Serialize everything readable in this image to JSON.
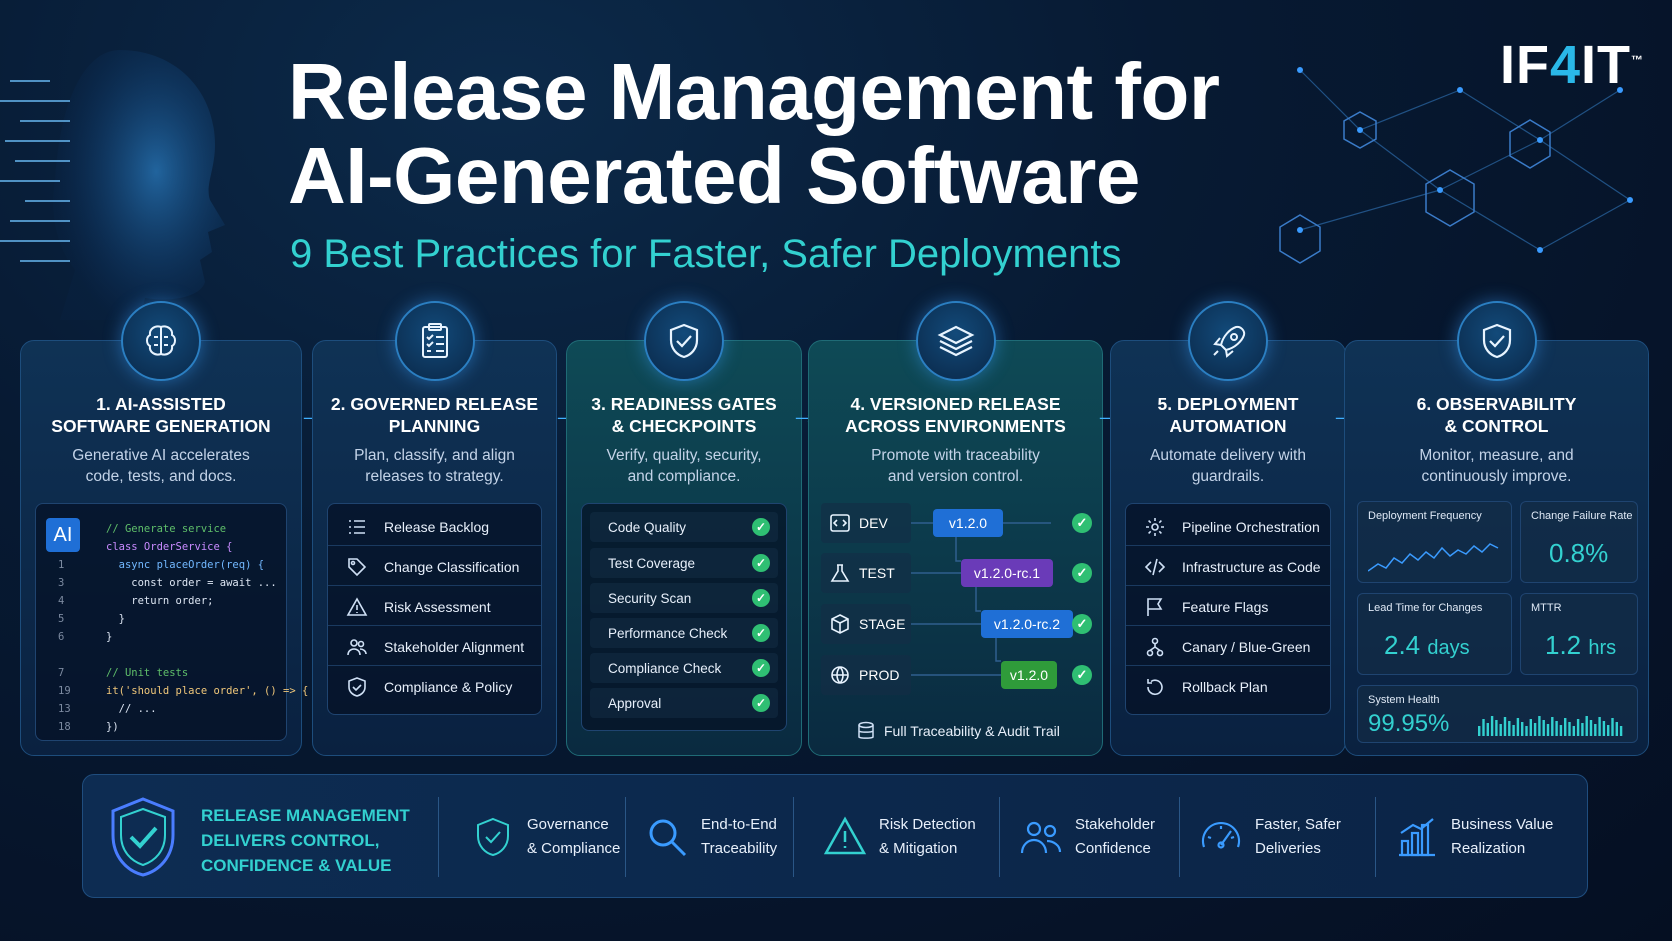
{
  "header": {
    "title_line1": "Release Management for",
    "title_line2": "AI-Generated Software",
    "subtitle": "9 Best Practices for Faster, Safer Deployments",
    "logo_prefix": "IF",
    "logo_four": "4",
    "logo_suffix": "IT",
    "logo_tm": "™"
  },
  "colors": {
    "accent_teal": "#33d1d0",
    "accent_blue": "#2ab8e8",
    "check_green": "#2fbf73",
    "background": "#071a33"
  },
  "steps": [
    {
      "title_line1": "1. AI-ASSISTED",
      "title_line2": "SOFTWARE GENERATION",
      "desc_line1": "Generative AI accelerates",
      "desc_line2": "code, tests, and docs.",
      "icon": "brain-icon"
    },
    {
      "title_line1": "2. GOVERNED RELEASE",
      "title_line2": "PLANNING",
      "desc_line1": "Plan, classify, and align",
      "desc_line2": "releases to strategy.",
      "icon": "clipboard-icon"
    },
    {
      "title_line1": "3. READINESS GATES",
      "title_line2": "& CHECKPOINTS",
      "desc_line1": "Verify, quality, security,",
      "desc_line2": "and compliance.",
      "icon": "shield-check-icon"
    },
    {
      "title_line1": "4. VERSIONED RELEASE",
      "title_line2": "ACROSS ENVIRONMENTS",
      "desc_line1": "Promote with traceability",
      "desc_line2": "and version control.",
      "icon": "layers-icon"
    },
    {
      "title_line1": "5. DEPLOYMENT",
      "title_line2": "AUTOMATION",
      "desc_line1": "Automate delivery with",
      "desc_line2": "guardrails.",
      "icon": "rocket-icon"
    },
    {
      "title_line1": "6. OBSERVABILITY",
      "title_line2": "& CONTROL",
      "desc_line1": "Monitor, measure, and",
      "desc_line2": "continuously improve.",
      "icon": "shield-check-icon"
    }
  ],
  "code": {
    "badge": "AI",
    "lines": [
      {
        "ln": "",
        "text": "// Generate service",
        "cls": "c-comment"
      },
      {
        "ln": "",
        "text": "class OrderService {",
        "cls": "c-kw"
      },
      {
        "ln": "1",
        "text": "  async placeOrder(req) {",
        "cls": "c-fn"
      },
      {
        "ln": "3",
        "text": "    const order = await ...",
        "cls": "c-plain"
      },
      {
        "ln": "4",
        "text": "    return order;",
        "cls": "c-plain"
      },
      {
        "ln": "5",
        "text": "  }",
        "cls": "c-plain"
      },
      {
        "ln": "6",
        "text": "}",
        "cls": "c-plain"
      },
      {
        "ln": "",
        "text": "",
        "cls": "c-plain"
      },
      {
        "ln": "7",
        "text": "// Unit tests",
        "cls": "c-comment"
      },
      {
        "ln": "19",
        "text": "it('should place order', () => {",
        "cls": "c-str"
      },
      {
        "ln": "13",
        "text": "  // ...",
        "cls": "c-plain"
      },
      {
        "ln": "18",
        "text": "})",
        "cls": "c-plain"
      }
    ]
  },
  "planning_items": [
    {
      "label": "Release Backlog",
      "icon": "list-icon"
    },
    {
      "label": "Change Classification",
      "icon": "tag-icon"
    },
    {
      "label": "Risk Assessment",
      "icon": "warning-icon"
    },
    {
      "label": "Stakeholder Alignment",
      "icon": "users-icon"
    },
    {
      "label": "Compliance & Policy",
      "icon": "shield-icon"
    }
  ],
  "gates": [
    {
      "label": "Code Quality"
    },
    {
      "label": "Test Coverage"
    },
    {
      "label": "Security Scan"
    },
    {
      "label": "Performance Check"
    },
    {
      "label": "Compliance Check"
    },
    {
      "label": "Approval"
    }
  ],
  "environments": [
    {
      "name": "DEV",
      "version": "v1.2.0",
      "icon": "code-icon"
    },
    {
      "name": "TEST",
      "version": "v1.2.0-rc.1",
      "icon": "flask-icon"
    },
    {
      "name": "STAGE",
      "version": "v1.2.0-rc.2",
      "icon": "cube-icon"
    },
    {
      "name": "PROD",
      "version": "v1.2.0",
      "icon": "globe-icon"
    }
  ],
  "traceability_label": "Full Traceability & Audit Trail",
  "automation_items": [
    {
      "label": "Pipeline Orchestration",
      "icon": "gear-icon"
    },
    {
      "label": "Infrastructure as Code",
      "icon": "code-icon"
    },
    {
      "label": "Feature Flags",
      "icon": "flag-icon"
    },
    {
      "label": "Canary / Blue-Green",
      "icon": "branch-icon"
    },
    {
      "label": "Rollback Plan",
      "icon": "rollback-icon"
    }
  ],
  "metrics": {
    "deploy_freq_label": "Deployment Frequency",
    "change_fail_label": "Change Failure Rate",
    "change_fail_value": "0.8%",
    "lead_time_label": "Lead Time for Changes",
    "lead_time_value": "2.4",
    "lead_time_unit": "days",
    "mttr_label": "MTTR",
    "mttr_value": "1.2",
    "mttr_unit": "hrs",
    "health_label": "System Health",
    "health_value": "99.95%"
  },
  "banner": {
    "headline_line1": "RELEASE MANAGEMENT",
    "headline_line2": "DELIVERS CONTROL,",
    "headline_line3": "CONFIDENCE & VALUE",
    "benefits": [
      {
        "line1": "Governance",
        "line2": "& Compliance",
        "icon": "shield-check-icon"
      },
      {
        "line1": "End-to-End",
        "line2": "Traceability",
        "icon": "search-icon"
      },
      {
        "line1": "Risk Detection",
        "line2": "& Mitigation",
        "icon": "warning-icon"
      },
      {
        "line1": "Stakeholder",
        "line2": "Confidence",
        "icon": "users-icon"
      },
      {
        "line1": "Faster, Safer",
        "line2": "Deliveries",
        "icon": "speedometer-icon"
      },
      {
        "line1": "Business Value",
        "line2": "Realization",
        "icon": "bar-chart-icon"
      }
    ]
  }
}
